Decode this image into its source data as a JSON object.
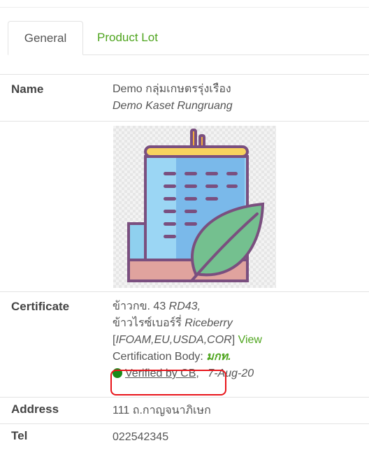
{
  "tabs": [
    {
      "label": "General",
      "active": true
    },
    {
      "label": "Product Lot",
      "active": false
    }
  ],
  "details": {
    "name": {
      "label": "Name",
      "line1": "Demo กลุ่มเกษตรรุ่งเรือง",
      "line2": "Demo Kaset Rungruang"
    },
    "logo": {
      "icon": "building-leaf-icon"
    },
    "certificate": {
      "label": "Certificate",
      "line1_thai": "ข้าวกข. 43",
      "line1_code": "RD43,",
      "line2_thai": "ข้าวไรซ์เบอร์รี่",
      "line2_en": "Riceberry",
      "standards_open": "[",
      "standards": "IFOAM,EU,USDA,COR",
      "standards_close": "]",
      "view_link": "View",
      "cb_label": "Certification Body:",
      "cb_value": "มกท.",
      "verified_text": "Verified by CB",
      "verified_sep": ",",
      "date": "7-Aug-20"
    },
    "address": {
      "label": "Address",
      "value": "111 ถ.กาญจนาภิเษก"
    },
    "tel": {
      "label": "Tel",
      "value": "022542345"
    }
  },
  "colors": {
    "accent": "#4fa51f",
    "verified_dot": "#1a8a1a",
    "highlight": "#e8141a"
  }
}
